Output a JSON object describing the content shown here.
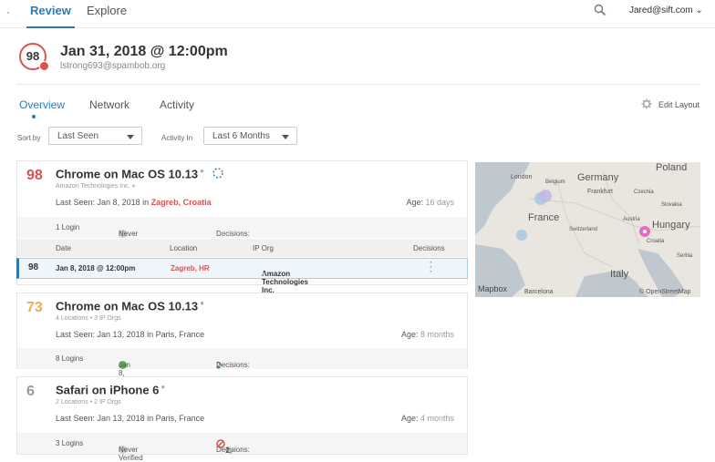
{
  "nav": {
    "dot": "·",
    "review": "Review",
    "explore": "Explore",
    "user": "Jared@sift.com ⌄"
  },
  "header": {
    "score": "98",
    "title": "Jan 31, 2018 @ 12:00pm",
    "email": "lstrong693@spambob.org"
  },
  "tabs": {
    "overview": "Overview",
    "network": "Network",
    "activity": "Activity",
    "edit_layout": "Edit Layout"
  },
  "filters": {
    "sort_by_label": "Sort by",
    "sort_by_value": "Last Seen",
    "activity_in_label": "Activity In",
    "activity_in_value": "Last 6 Months"
  },
  "colors": {
    "accent": "#2a7ab8",
    "risk_high": "#d9534f",
    "risk_mid": "#f0ad4e",
    "risk_low": "#999999",
    "verified": "#5cb85c"
  },
  "cards": [
    {
      "score": "98",
      "device": "Chrome on Mac OS 10.13",
      "sub": "Amazon Technologies Inc.",
      "last_seen_label": "Last Seen:",
      "last_seen_date": "Jan 8, 2018 in",
      "last_seen_place": "Zagreb, Croatia",
      "age_label": "Age:",
      "age_value": "16 days",
      "logins": "1 Login",
      "verified": "Never Verified",
      "decisions_label": "Decisions:",
      "decisions_value": "—",
      "table_headers": [
        "Date",
        "Location",
        "IP Org",
        "Decisions"
      ],
      "row": {
        "score": "98",
        "date": "Jan 8, 2018 @ 12:00pm",
        "location": "Zagreb, HR",
        "ip_org": "Amazon Technologies Inc."
      }
    },
    {
      "score": "73",
      "device": "Chrome on Mac OS 10.13",
      "sub": "4 Locations  •  3 IP Orgs",
      "last_seen_label": "Last Seen:",
      "last_seen_date": "Jan 13, 2018 in Paris, France",
      "age_label": "Age:",
      "age_value": "8 months",
      "logins": "8 Logins",
      "verified": "Jan 8, 2018",
      "decisions_label": "Decisions:",
      "decisions_accept": "2"
    },
    {
      "score": "6",
      "device": "Safari on iPhone 6",
      "sub": "2 Locations  •  2 IP Orgs",
      "last_seen_label": "Last Seen:",
      "last_seen_date": "Jan 13, 2018 in Paris, France",
      "age_label": "Age:",
      "age_value": "4 months",
      "logins": "3 Logins",
      "verified": "Never Verified",
      "decisions_label": "Decisions:",
      "decisions_block": "2",
      "decisions_accept": "1"
    }
  ],
  "map": {
    "labels": [
      "London",
      "Belgium",
      "Germany",
      "Poland",
      "Frankfurt",
      "Czechia",
      "France",
      "Slovakia",
      "Austria",
      "Hungary",
      "Switzerland",
      "Croatia",
      "Serbia",
      "Italy",
      "Barcelona",
      "© OpenStreetMap",
      "Mapbox"
    ]
  }
}
